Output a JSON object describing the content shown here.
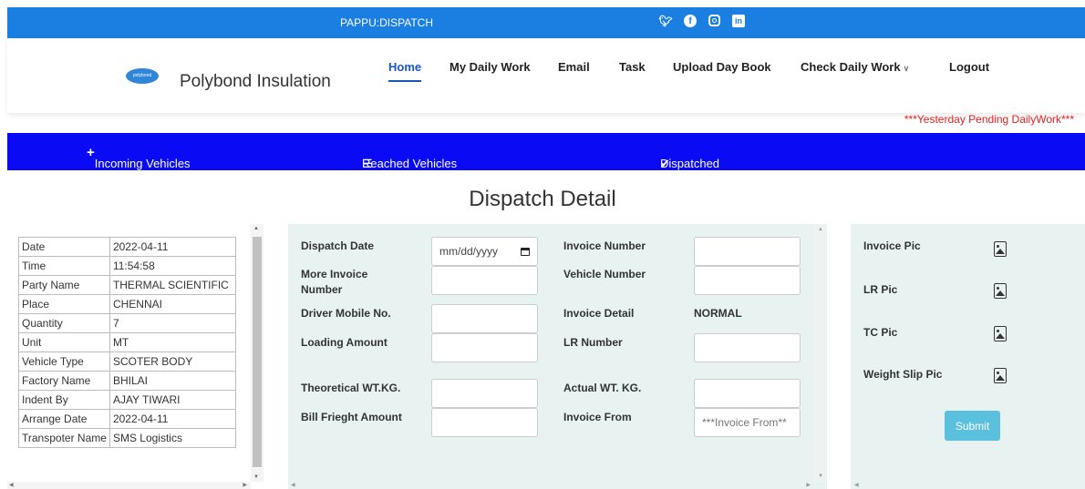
{
  "topbar": {
    "title": "PAPPU:DISPATCH"
  },
  "social": {
    "twitter": "🐦",
    "facebook": "f",
    "linkedin": "in"
  },
  "header": {
    "brand": "Polybond Insulation",
    "logo_text": "polybond"
  },
  "nav": [
    {
      "label": "Home",
      "active": true
    },
    {
      "label": "My Daily Work"
    },
    {
      "label": "Email"
    },
    {
      "label": "Task"
    },
    {
      "label": "Upload Day Book"
    },
    {
      "label": "Check Daily Work"
    },
    {
      "label": "Logout"
    }
  ],
  "pending_notice": "***Yesterday Pending DailyWork***",
  "tabs": {
    "incoming": "Incoming Vehicles",
    "reached": "Reached Vehicles",
    "dispatched": "Dispatched"
  },
  "page_title": "Dispatch Detail",
  "info": {
    "rows": [
      {
        "k": "Date",
        "v": "2022-04-11"
      },
      {
        "k": "Time",
        "v": "11:54:58"
      },
      {
        "k": "Party Name",
        "v": "THERMAL SCIENTIFIC"
      },
      {
        "k": "Place",
        "v": "CHENNAI"
      },
      {
        "k": "Quantity",
        "v": "7"
      },
      {
        "k": "Unit",
        "v": "MT"
      },
      {
        "k": "Vehicle Type",
        "v": "SCOTER BODY"
      },
      {
        "k": "Factory Name",
        "v": "BHILAI"
      },
      {
        "k": "Indent By",
        "v": "AJAY TIWARI"
      },
      {
        "k": "Arrange Date",
        "v": "2022-04-11"
      },
      {
        "k": "Transpoter Name",
        "v": "SMS Logistics"
      }
    ]
  },
  "form": {
    "dispatch_date": "Dispatch Date",
    "date_placeholder": "mm/dd/yyyy",
    "more_invoice": "More Invoice",
    "number": "Number",
    "driver_mobile": "Driver Mobile No.",
    "loading_amount": "Loading Amount",
    "theoretical_wt": "Theoretical WT.KG.",
    "bill_freight": "Bill Frieght Amount",
    "invoice_number": "Invoice Number",
    "vehicle_number": "Vehicle Number",
    "invoice_detail": "Invoice Detail",
    "invoice_detail_value": "NORMAL",
    "lr_number": "LR Number",
    "actual_wt": "Actual WT. KG.",
    "invoice_from": "Invoice From",
    "invoice_from_placeholder": "***Invoice From**"
  },
  "pics": {
    "invoice": "Invoice Pic",
    "lr": "LR Pic",
    "tc": "TC Pic",
    "weight": "Weight Slip Pic",
    "submit": "Submit"
  }
}
